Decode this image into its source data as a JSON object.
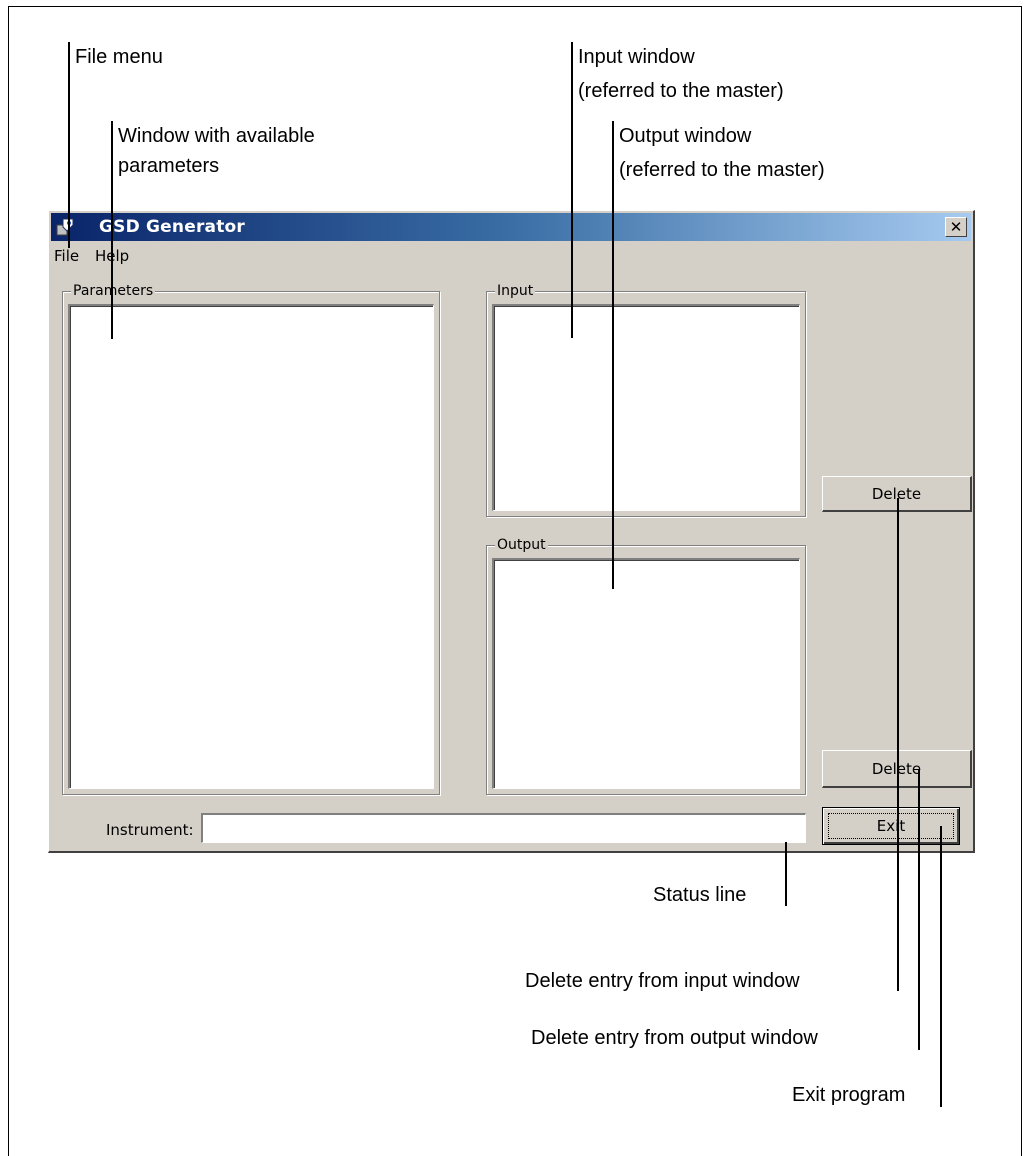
{
  "callouts": {
    "file_menu": "File menu",
    "params_window_line1": "Window with available",
    "params_window_line2": "parameters",
    "input_window_line1": "Input window",
    "input_window_line2": "(referred to the master)",
    "output_window_line1": "Output window",
    "output_window_line2": "(referred to the master)",
    "status_line": "Status line",
    "delete_input": "Delete entry from input window",
    "delete_output": "Delete entry from output window",
    "exit_program": "Exit program"
  },
  "window": {
    "title": "GSD Generator",
    "close_glyph": "✕",
    "menu": [
      "File",
      "Help"
    ],
    "groups": {
      "parameters": "Parameters",
      "input": "Input",
      "output": "Output"
    },
    "buttons": {
      "delete_input": "Delete",
      "delete_output": "Delete",
      "exit": "Exit"
    },
    "status_label": "Instrument:",
    "status_value": ""
  },
  "colors": {
    "dialog_bg": "#d4d0c8",
    "titlebar_start": "#0a246a",
    "titlebar_end": "#a6caf0"
  }
}
